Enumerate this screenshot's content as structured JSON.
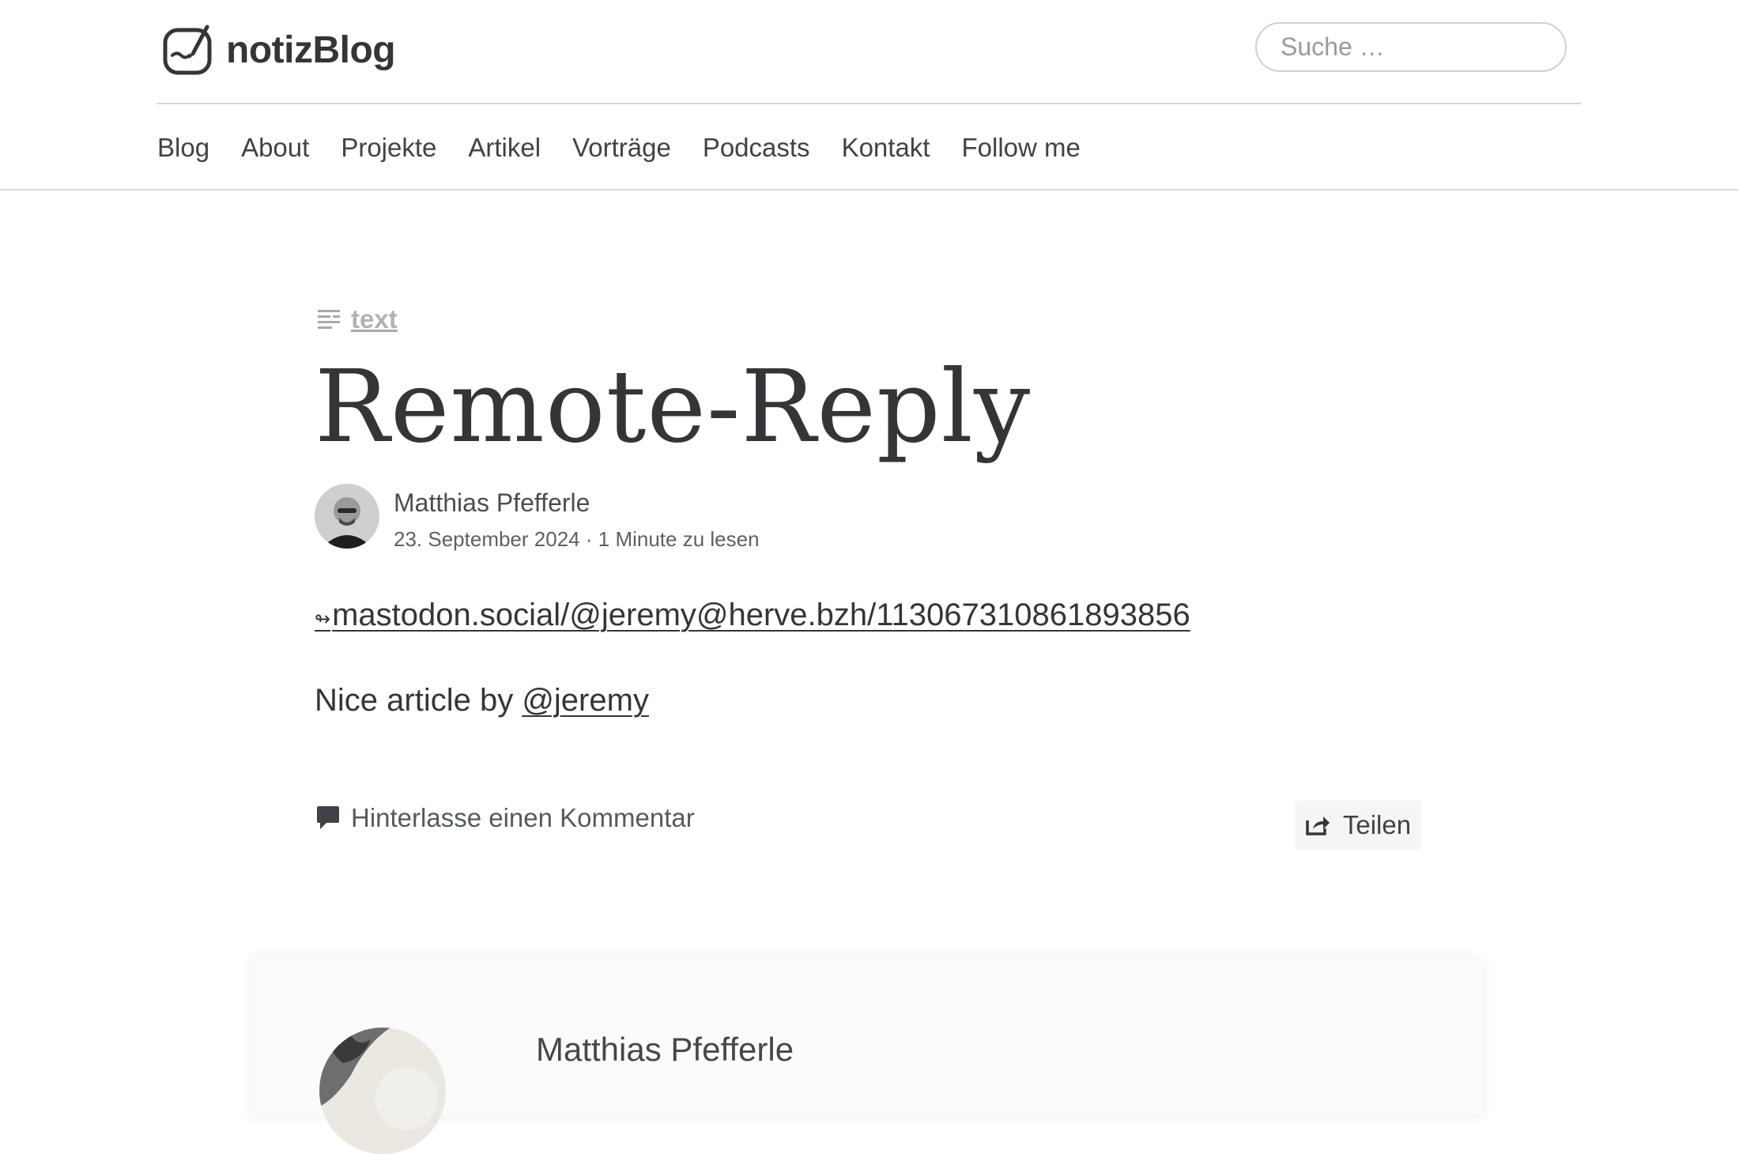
{
  "site": {
    "name": "notizBlog",
    "logo_icon": "notepad-pen-icon"
  },
  "search": {
    "placeholder": "Suche …"
  },
  "nav": {
    "items": [
      {
        "label": "Blog"
      },
      {
        "label": "About"
      },
      {
        "label": "Projekte"
      },
      {
        "label": "Artikel"
      },
      {
        "label": "Vorträge"
      },
      {
        "label": "Podcasts"
      },
      {
        "label": "Kontakt"
      },
      {
        "label": "Follow me"
      }
    ]
  },
  "post": {
    "format_label": "text",
    "format_icon": "text-lines-icon",
    "title": "Remote-Reply",
    "author": "Matthias Pfefferle",
    "date": "23. September 2024",
    "separator": "·",
    "reading_time": "1 Minute zu lesen",
    "reply_glyph": "↬",
    "reply_url_text": "mastodon.social/@jeremy@herve.bzh/113067310861893856",
    "body_prefix": "Nice article by ",
    "body_mention": "@jeremy",
    "comment_label": "Hinterlasse einen Kommentar",
    "comment_icon": "speech-bubble-icon",
    "share_label": "Teilen",
    "share_icon": "share-icon"
  },
  "author_box": {
    "name": "Matthias Pfefferle"
  },
  "colors": {
    "text": "#333639",
    "muted": "#a7a9ac",
    "border": "#dcdcdc",
    "share_bg": "#f5f5f5"
  }
}
